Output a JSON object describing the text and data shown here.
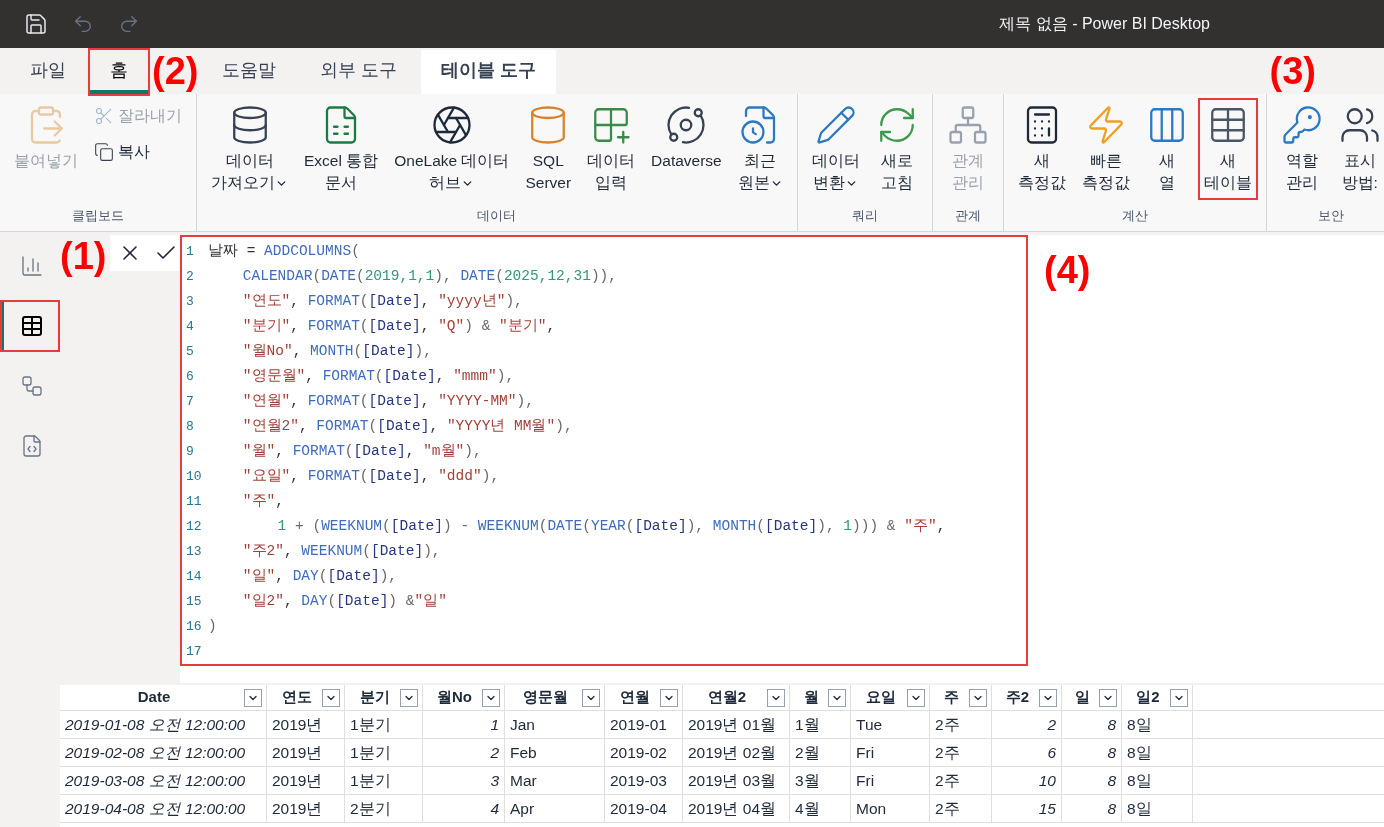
{
  "title_bar": {
    "title": "제목 없음 - Power BI Desktop"
  },
  "tabs": [
    {
      "label": "파일",
      "selected": false,
      "contextual": false,
      "highlighted": false
    },
    {
      "label": "홈",
      "selected": true,
      "contextual": false,
      "highlighted": true
    },
    {
      "label": "도움말",
      "selected": false,
      "contextual": false,
      "highlighted": false
    },
    {
      "label": "외부 도구",
      "selected": false,
      "contextual": false,
      "highlighted": false
    },
    {
      "label": "테이블 도구",
      "selected": false,
      "contextual": true,
      "highlighted": false
    }
  ],
  "ribbon": {
    "groups": [
      {
        "label": "클립보드",
        "buttons": [
          {
            "kind": "large",
            "lines": [
              "붙여넣기"
            ],
            "disabled": true,
            "dropdown": false,
            "highlighted": false
          },
          {
            "kind": "small",
            "lines": [
              "잘라내기"
            ],
            "disabled": true,
            "dropdown": false,
            "highlighted": false
          },
          {
            "kind": "small",
            "lines": [
              "복사"
            ],
            "disabled": false,
            "dropdown": false,
            "highlighted": false
          }
        ]
      },
      {
        "label": "데이터",
        "buttons": [
          {
            "kind": "large",
            "lines": [
              "데이터",
              "가져오기"
            ],
            "disabled": false,
            "dropdown": true,
            "highlighted": false
          },
          {
            "kind": "large",
            "lines": [
              "Excel 통합",
              "문서"
            ],
            "disabled": false,
            "dropdown": false,
            "highlighted": false
          },
          {
            "kind": "large",
            "lines": [
              "OneLake 데이터",
              "허브"
            ],
            "disabled": false,
            "dropdown": true,
            "highlighted": false
          },
          {
            "kind": "large",
            "lines": [
              "SQL",
              "Server"
            ],
            "disabled": false,
            "dropdown": false,
            "highlighted": false
          },
          {
            "kind": "large",
            "lines": [
              "데이터",
              "입력"
            ],
            "disabled": false,
            "dropdown": false,
            "highlighted": false
          },
          {
            "kind": "large",
            "lines": [
              "Dataverse"
            ],
            "disabled": false,
            "dropdown": false,
            "highlighted": false
          },
          {
            "kind": "large",
            "lines": [
              "최근",
              "원본"
            ],
            "disabled": false,
            "dropdown": true,
            "highlighted": false
          }
        ]
      },
      {
        "label": "쿼리",
        "buttons": [
          {
            "kind": "large",
            "lines": [
              "데이터",
              "변환"
            ],
            "disabled": false,
            "dropdown": true,
            "highlighted": false
          },
          {
            "kind": "large",
            "lines": [
              "새로",
              "고침"
            ],
            "disabled": false,
            "dropdown": false,
            "highlighted": false
          }
        ]
      },
      {
        "label": "관계",
        "buttons": [
          {
            "kind": "large",
            "lines": [
              "관계",
              "관리"
            ],
            "disabled": true,
            "dropdown": false,
            "highlighted": false
          }
        ]
      },
      {
        "label": "계산",
        "buttons": [
          {
            "kind": "large",
            "lines": [
              "새",
              "측정값"
            ],
            "disabled": false,
            "dropdown": false,
            "highlighted": false
          },
          {
            "kind": "large",
            "lines": [
              "빠른",
              "측정값"
            ],
            "disabled": false,
            "dropdown": false,
            "highlighted": false
          },
          {
            "kind": "large",
            "lines": [
              "새",
              "열"
            ],
            "disabled": false,
            "dropdown": false,
            "highlighted": false
          },
          {
            "kind": "large",
            "lines": [
              "새",
              "테이블"
            ],
            "disabled": false,
            "dropdown": false,
            "highlighted": true
          }
        ]
      },
      {
        "label": "보안",
        "buttons": [
          {
            "kind": "large",
            "lines": [
              "역할",
              "관리"
            ],
            "disabled": false,
            "dropdown": false,
            "highlighted": false
          },
          {
            "kind": "large",
            "lines": [
              "표시",
              "방법:"
            ],
            "disabled": false,
            "dropdown": false,
            "highlighted": false
          }
        ]
      }
    ]
  },
  "annotations": [
    {
      "text": "(1)"
    },
    {
      "text": "(2)"
    },
    {
      "text": "(3)"
    },
    {
      "text": "(4)"
    }
  ],
  "sidebar": {
    "items": [
      {
        "selected": false,
        "highlighted": false
      },
      {
        "selected": true,
        "highlighted": true
      },
      {
        "selected": false,
        "highlighted": false
      },
      {
        "selected": false,
        "highlighted": false
      }
    ]
  },
  "editor": {
    "highlighted": true,
    "lines": [
      {
        "number": "1",
        "tokens": [
          {
            "kind": "plain",
            "text": "날짜 = "
          },
          {
            "kind": "fn",
            "text": "ADDCOLUMNS"
          },
          {
            "kind": "paren",
            "text": "("
          }
        ]
      },
      {
        "number": "2",
        "tokens": [
          {
            "kind": "fn",
            "text": "    CALENDAR"
          },
          {
            "kind": "paren",
            "text": "("
          },
          {
            "kind": "fn",
            "text": "DATE"
          },
          {
            "kind": "paren",
            "text": "("
          },
          {
            "kind": "num",
            "text": "2019,1,1"
          },
          {
            "kind": "paren",
            "text": "), "
          },
          {
            "kind": "fn",
            "text": "DATE"
          },
          {
            "kind": "paren",
            "text": "("
          },
          {
            "kind": "num",
            "text": "2025,12,31"
          },
          {
            "kind": "paren",
            "text": ")),"
          }
        ]
      },
      {
        "number": "3",
        "tokens": [
          {
            "kind": "str",
            "text": "    \"연도\""
          },
          {
            "kind": "plain",
            "text": ", "
          },
          {
            "kind": "fn",
            "text": "FORMAT"
          },
          {
            "kind": "paren",
            "text": "("
          },
          {
            "kind": "col",
            "text": "[Date]"
          },
          {
            "kind": "plain",
            "text": ", "
          },
          {
            "kind": "str",
            "text": "\"yyyy년\""
          },
          {
            "kind": "paren",
            "text": "),"
          }
        ]
      },
      {
        "number": "4",
        "tokens": [
          {
            "kind": "str",
            "text": "    \"분기\""
          },
          {
            "kind": "plain",
            "text": ", "
          },
          {
            "kind": "fn",
            "text": "FORMAT"
          },
          {
            "kind": "paren",
            "text": "("
          },
          {
            "kind": "col",
            "text": "[Date]"
          },
          {
            "kind": "plain",
            "text": ", "
          },
          {
            "kind": "str",
            "text": "\"Q\""
          },
          {
            "kind": "paren",
            "text": ") & "
          },
          {
            "kind": "str",
            "text": "\"분기\""
          },
          {
            "kind": "plain",
            "text": ","
          }
        ]
      },
      {
        "number": "5",
        "tokens": [
          {
            "kind": "str",
            "text": "    \"월No\""
          },
          {
            "kind": "plain",
            "text": ", "
          },
          {
            "kind": "fn",
            "text": "MONTH"
          },
          {
            "kind": "paren",
            "text": "("
          },
          {
            "kind": "col",
            "text": "[Date]"
          },
          {
            "kind": "paren",
            "text": "),"
          }
        ]
      },
      {
        "number": "6",
        "tokens": [
          {
            "kind": "str",
            "text": "    \"영문월\""
          },
          {
            "kind": "plain",
            "text": ", "
          },
          {
            "kind": "fn",
            "text": "FORMAT"
          },
          {
            "kind": "paren",
            "text": "("
          },
          {
            "kind": "col",
            "text": "[Date]"
          },
          {
            "kind": "plain",
            "text": ", "
          },
          {
            "kind": "str",
            "text": "\"mmm\""
          },
          {
            "kind": "paren",
            "text": "),"
          }
        ]
      },
      {
        "number": "7",
        "tokens": [
          {
            "kind": "str",
            "text": "    \"연월\""
          },
          {
            "kind": "plain",
            "text": ", "
          },
          {
            "kind": "fn",
            "text": "FORMAT"
          },
          {
            "kind": "paren",
            "text": "("
          },
          {
            "kind": "col",
            "text": "[Date]"
          },
          {
            "kind": "plain",
            "text": ", "
          },
          {
            "kind": "str",
            "text": "\"YYYY-MM\""
          },
          {
            "kind": "paren",
            "text": "),"
          }
        ]
      },
      {
        "number": "8",
        "tokens": [
          {
            "kind": "str",
            "text": "    \"연월2\""
          },
          {
            "kind": "plain",
            "text": ", "
          },
          {
            "kind": "fn",
            "text": "FORMAT"
          },
          {
            "kind": "paren",
            "text": "("
          },
          {
            "kind": "col",
            "text": "[Date]"
          },
          {
            "kind": "plain",
            "text": ", "
          },
          {
            "kind": "str",
            "text": "\"YYYY년 MM월\""
          },
          {
            "kind": "paren",
            "text": "),"
          }
        ]
      },
      {
        "number": "9",
        "tokens": [
          {
            "kind": "str",
            "text": "    \"월\""
          },
          {
            "kind": "plain",
            "text": ", "
          },
          {
            "kind": "fn",
            "text": "FORMAT"
          },
          {
            "kind": "paren",
            "text": "("
          },
          {
            "kind": "col",
            "text": "[Date]"
          },
          {
            "kind": "plain",
            "text": ", "
          },
          {
            "kind": "str",
            "text": "\"m월\""
          },
          {
            "kind": "paren",
            "text": "),"
          }
        ]
      },
      {
        "number": "10",
        "tokens": [
          {
            "kind": "str",
            "text": "    \"요일\""
          },
          {
            "kind": "plain",
            "text": ", "
          },
          {
            "kind": "fn",
            "text": "FORMAT"
          },
          {
            "kind": "paren",
            "text": "("
          },
          {
            "kind": "col",
            "text": "[Date]"
          },
          {
            "kind": "plain",
            "text": ", "
          },
          {
            "kind": "str",
            "text": "\"ddd\""
          },
          {
            "kind": "paren",
            "text": "),"
          }
        ]
      },
      {
        "number": "11",
        "tokens": [
          {
            "kind": "str",
            "text": "    \"주\""
          },
          {
            "kind": "plain",
            "text": ","
          }
        ]
      },
      {
        "number": "12",
        "tokens": [
          {
            "kind": "num",
            "text": "        1"
          },
          {
            "kind": "paren",
            "text": " + ("
          },
          {
            "kind": "fn",
            "text": "WEEKNUM"
          },
          {
            "kind": "paren",
            "text": "("
          },
          {
            "kind": "col",
            "text": "[Date]"
          },
          {
            "kind": "paren",
            "text": ") - "
          },
          {
            "kind": "fn",
            "text": "WEEKNUM"
          },
          {
            "kind": "paren",
            "text": "("
          },
          {
            "kind": "fn",
            "text": "DATE"
          },
          {
            "kind": "paren",
            "text": "("
          },
          {
            "kind": "fn",
            "text": "YEAR"
          },
          {
            "kind": "paren",
            "text": "("
          },
          {
            "kind": "col",
            "text": "[Date]"
          },
          {
            "kind": "paren",
            "text": "), "
          },
          {
            "kind": "fn",
            "text": "MONTH"
          },
          {
            "kind": "paren",
            "text": "("
          },
          {
            "kind": "col",
            "text": "[Date]"
          },
          {
            "kind": "paren",
            "text": "), "
          },
          {
            "kind": "num",
            "text": "1"
          },
          {
            "kind": "paren",
            "text": "))) & "
          },
          {
            "kind": "str",
            "text": "\"주\""
          },
          {
            "kind": "plain",
            "text": ","
          }
        ]
      },
      {
        "number": "13",
        "tokens": [
          {
            "kind": "str",
            "text": "    \"주2\""
          },
          {
            "kind": "plain",
            "text": ", "
          },
          {
            "kind": "fn",
            "text": "WEEKNUM"
          },
          {
            "kind": "paren",
            "text": "("
          },
          {
            "kind": "col",
            "text": "[Date]"
          },
          {
            "kind": "paren",
            "text": "),"
          }
        ]
      },
      {
        "number": "14",
        "tokens": [
          {
            "kind": "str",
            "text": "    \"일\""
          },
          {
            "kind": "plain",
            "text": ", "
          },
          {
            "kind": "fn",
            "text": "DAY"
          },
          {
            "kind": "paren",
            "text": "("
          },
          {
            "kind": "col",
            "text": "[Date]"
          },
          {
            "kind": "paren",
            "text": "),"
          }
        ]
      },
      {
        "number": "15",
        "tokens": [
          {
            "kind": "str",
            "text": "    \"일2\""
          },
          {
            "kind": "plain",
            "text": ", "
          },
          {
            "kind": "fn",
            "text": "DAY"
          },
          {
            "kind": "paren",
            "text": "("
          },
          {
            "kind": "col",
            "text": "[Date]"
          },
          {
            "kind": "paren",
            "text": ") &"
          },
          {
            "kind": "str",
            "text": "\"일\""
          }
        ]
      },
      {
        "number": "16",
        "tokens": [
          {
            "kind": "paren",
            "text": ")"
          }
        ]
      },
      {
        "number": "17"
      }
    ]
  },
  "table": {
    "columns": [
      {
        "label": "Date",
        "kind": "datetime"
      },
      {
        "label": "연도",
        "kind": "text"
      },
      {
        "label": "분기",
        "kind": "text"
      },
      {
        "label": "월No",
        "kind": "number"
      },
      {
        "label": "영문월",
        "kind": "text"
      },
      {
        "label": "연월",
        "kind": "text"
      },
      {
        "label": "연월2",
        "kind": "text"
      },
      {
        "label": "월",
        "kind": "text"
      },
      {
        "label": "요일",
        "kind": "text"
      },
      {
        "label": "주",
        "kind": "text"
      },
      {
        "label": "주2",
        "kind": "number"
      },
      {
        "label": "일",
        "kind": "number"
      },
      {
        "label": "일2",
        "kind": "text"
      }
    ],
    "rows": [
      [
        "2019-01-08 오전 12:00:00",
        "2019년",
        "1분기",
        "1",
        "Jan",
        "2019-01",
        "2019년 01월",
        "1월",
        "Tue",
        "2주",
        "2",
        "8",
        "8일"
      ],
      [
        "2019-02-08 오전 12:00:00",
        "2019년",
        "1분기",
        "2",
        "Feb",
        "2019-02",
        "2019년 02월",
        "2월",
        "Fri",
        "2주",
        "6",
        "8",
        "8일"
      ],
      [
        "2019-03-08 오전 12:00:00",
        "2019년",
        "1분기",
        "3",
        "Mar",
        "2019-03",
        "2019년 03월",
        "3월",
        "Fri",
        "2주",
        "10",
        "8",
        "8일"
      ],
      [
        "2019-04-08 오전 12:00:00",
        "2019년",
        "2분기",
        "4",
        "Apr",
        "2019-04",
        "2019년 04월",
        "4월",
        "Mon",
        "2주",
        "15",
        "8",
        "8일"
      ]
    ]
  }
}
